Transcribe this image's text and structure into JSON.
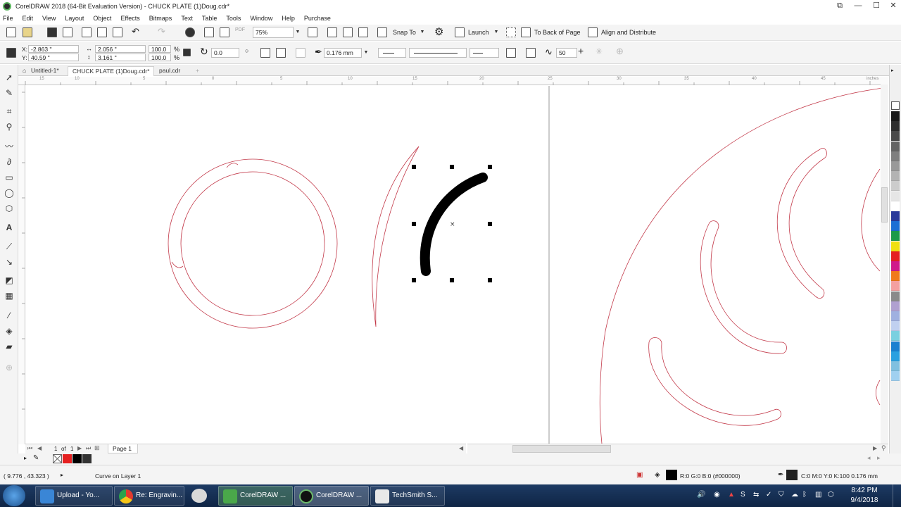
{
  "window": {
    "title": "CorelDRAW 2018 (64-Bit Evaluation Version) - CHUCK PLATE (1)Doug.cdr*",
    "controls": [
      "⧉",
      "—",
      "☐",
      "✕"
    ]
  },
  "menu": [
    "File",
    "Edit",
    "View",
    "Layout",
    "Object",
    "Effects",
    "Bitmaps",
    "Text",
    "Table",
    "Tools",
    "Window",
    "Help",
    "Purchase"
  ],
  "toolbar1": {
    "zoom": "75%",
    "snap_to": "Snap To",
    "launch": "Launch",
    "to_back_of_page": "To Back of Page",
    "align_distribute": "Align and Distribute",
    "pdf_label": "PDF"
  },
  "toolbar2": {
    "x_label": "X:",
    "x": "-2.863 \"",
    "y_label": "Y:",
    "y": "40.59 \"",
    "w": "2.056 \"",
    "h": "3.161 \"",
    "scale_x": "100.0",
    "scale_y": "100.0",
    "pct": "%",
    "rotation": "0.0",
    "outline_width": "0.176 mm",
    "smoothing": "50"
  },
  "tabs": [
    "Untitled-1*",
    "CHUCK PLATE (1)Doug.cdr*",
    "paul.cdr"
  ],
  "ruler": {
    "h_ticks": [
      "15",
      "10",
      "5",
      "0",
      "5",
      "10",
      "15",
      "20",
      "25",
      "30",
      "35",
      "40",
      "45"
    ],
    "unit": "inches"
  },
  "pagenav": {
    "current": "1",
    "of": "of",
    "total": "1",
    "page": "Page 1"
  },
  "status": {
    "coords": "( 9.776 , 43.323 )",
    "object_info": "Curve on Layer 1",
    "fill": "R:0 G:0 B:0 (#000000)",
    "outline": "C:0 M:0 Y:0 K:100  0.176 mm"
  },
  "palette_colors": [
    "#1a1a1a",
    "#2e2e2e",
    "#4a4a4a",
    "#646464",
    "#7f7f7f",
    "#999999",
    "#b3b3b3",
    "#cccccc",
    "#e6e6e6",
    "#ffffff",
    "#2a3a9a",
    "#1d6fd4",
    "#1a9a4a",
    "#f0e010",
    "#e52020",
    "#d01a8a",
    "#f07a1a",
    "#f4a0a0",
    "#8a8a8a",
    "#b0a0d0",
    "#a0b0e0",
    "#c0d0f0",
    "#7ad0e0",
    "#1a80d0",
    "#2aa0e0",
    "#80c0e0",
    "#a0d0f0"
  ],
  "colorbar_swatches": [
    "#e52020",
    "#000000",
    "#333333"
  ],
  "taskbar": {
    "items": [
      "Upload - Yo...",
      "Re: Engravin...",
      "CorelDRAW ...",
      "CorelDRAW ...",
      "TechSmith S..."
    ],
    "time": "8:42 PM",
    "date": "9/4/2018"
  }
}
